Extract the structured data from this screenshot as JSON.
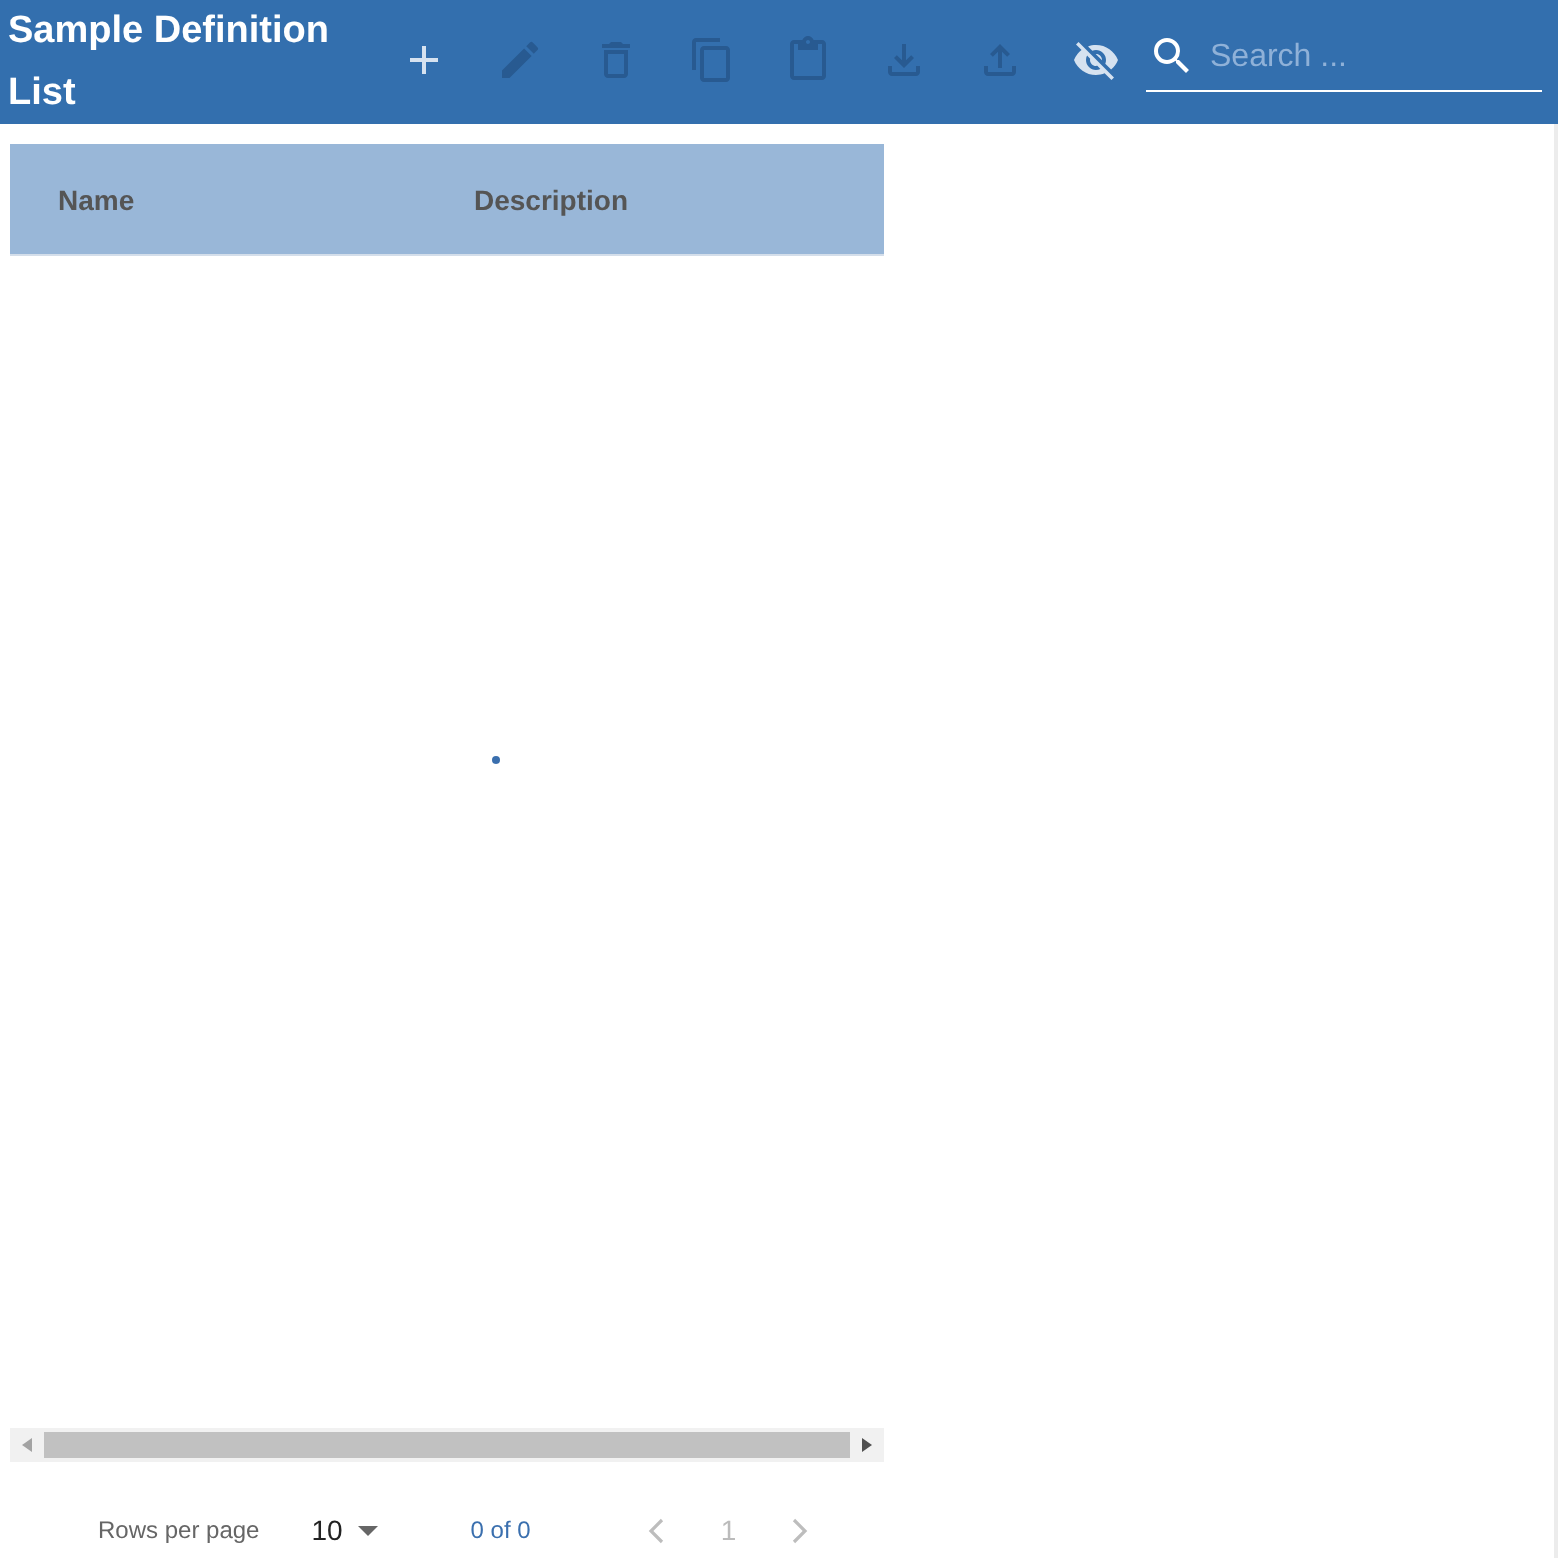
{
  "header": {
    "title": "Sample Definition List",
    "actions": [
      {
        "kind": "add",
        "disabled": false
      },
      {
        "kind": "edit",
        "disabled": true
      },
      {
        "kind": "delete",
        "disabled": true
      },
      {
        "kind": "copy",
        "disabled": true
      },
      {
        "kind": "paste",
        "disabled": true
      },
      {
        "kind": "download",
        "disabled": true
      },
      {
        "kind": "upload",
        "disabled": true
      },
      {
        "kind": "hide",
        "disabled": false
      }
    ],
    "search": {
      "placeholder": "Search ..."
    }
  },
  "table": {
    "columns": [
      "Name",
      "Description"
    ],
    "loading": true
  },
  "pagination": {
    "rows_per_page_label": "Rows per page",
    "rows_per_page": "10",
    "range": "0 of 0",
    "page": "1",
    "previous_disabled": true,
    "next_disabled": true
  }
}
